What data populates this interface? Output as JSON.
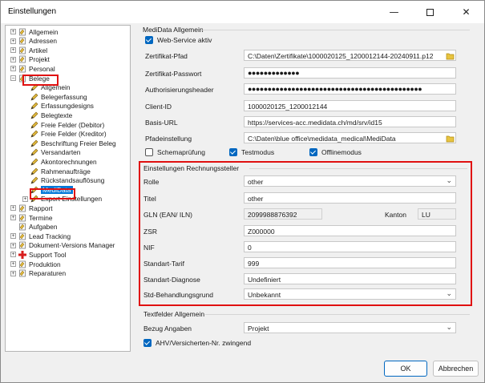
{
  "window": {
    "title": "Einstellungen"
  },
  "tree": {
    "items": [
      {
        "label": "Allgemein",
        "level": 0,
        "expander": "+"
      },
      {
        "label": "Adressen",
        "level": 0,
        "expander": "+"
      },
      {
        "label": "Artikel",
        "level": 0,
        "expander": "+"
      },
      {
        "label": "Projekt",
        "level": 0,
        "expander": "+"
      },
      {
        "label": "Personal",
        "level": 0,
        "expander": "+"
      },
      {
        "label": "Belege",
        "level": 0,
        "expander": "-"
      },
      {
        "label": "Allgemein",
        "level": 1
      },
      {
        "label": "Belegerfassung",
        "level": 1
      },
      {
        "label": "Erfassungdesigns",
        "level": 1
      },
      {
        "label": "Belegtexte",
        "level": 1
      },
      {
        "label": "Freie Felder (Debitor)",
        "level": 1
      },
      {
        "label": "Freie Felder (Kreditor)",
        "level": 1
      },
      {
        "label": "Beschriftung Freier Beleg",
        "level": 1
      },
      {
        "label": "Versandarten",
        "level": 1
      },
      {
        "label": "Akontorechnungen",
        "level": 1
      },
      {
        "label": "Rahmenaufträge",
        "level": 1
      },
      {
        "label": "Rückstandsauflösung",
        "level": 1
      },
      {
        "label": "MediData",
        "level": 1
      },
      {
        "label": "Export Einstellungen",
        "level": 1,
        "expander": "+"
      },
      {
        "label": "Rapport",
        "level": 0,
        "expander": "+"
      },
      {
        "label": "Termine",
        "level": 0,
        "expander": "+"
      },
      {
        "label": "Aufgaben",
        "level": 0
      },
      {
        "label": "Lead Tracking",
        "level": 0,
        "expander": "+"
      },
      {
        "label": "Dokument-Versions Manager",
        "level": 0,
        "expander": "+"
      },
      {
        "label": "Support Tool",
        "level": 0,
        "expander": "+"
      },
      {
        "label": "Produktion",
        "level": 0,
        "expander": "+"
      },
      {
        "label": "Reparaturen",
        "level": 0,
        "expander": "+"
      }
    ]
  },
  "medidata": {
    "section_title": "MediData Allgemein",
    "webservice_label": "Web-Service aktiv",
    "zertifikat_pfad_label": "Zertifikat-Pfad",
    "zertifikat_pfad_value": "C:\\Daten\\Zertifikate\\1000020125_1200012144-20240911.p12",
    "zertifikat_passwort_label": "Zertifikat-Passwort",
    "zertifikat_passwort_value": "●●●●●●●●●●●●●",
    "auth_header_label": "Authorisierungsheader",
    "auth_header_value": "●●●●●●●●●●●●●●●●●●●●●●●●●●●●●●●●●●●●●●●●●●●●",
    "client_id_label": "Client-ID",
    "client_id_value": "1000020125_1200012144",
    "basis_url_label": "Basis-URL",
    "basis_url_value": "https://services-acc.medidata.ch/md/srv/id15",
    "pfad_label": "Pfadeinstellung",
    "pfad_value": "C:\\Daten\\blue office\\medidata_medical\\MediData",
    "schema_label": "Schemaprüfung",
    "test_label": "Testmodus",
    "offline_label": "Offlinemodus"
  },
  "rechnung": {
    "section_title": "Einstellungen Rechnungssteller",
    "rolle_label": "Rolle",
    "rolle_value": "other",
    "titel_label": "Titel",
    "titel_value": "other",
    "gln_label": "GLN (EAN/ ILN)",
    "gln_value": "2099988876392",
    "kanton_label": "Kanton",
    "kanton_value": "LU",
    "zsr_label": "ZSR",
    "zsr_value": "Z000000",
    "nif_label": "NIF",
    "nif_value": "0",
    "tarif_label": "Standart-Tarif",
    "tarif_value": "999",
    "diagnose_label": "Standart-Diagnose",
    "diagnose_value": "Undefiniert",
    "grund_label": "Std-Behandlungsgrund",
    "grund_value": "Unbekannt"
  },
  "textfelder": {
    "section_title": "Textfelder Allgemein",
    "bezug_label": "Bezug Angaben",
    "bezug_value": "Projekt",
    "ahv_label": "AHV/Versicherten-Nr. zwingend"
  },
  "buttons": {
    "ok": "OK",
    "cancel": "Abbrechen"
  },
  "colors": {
    "accent": "#0067c0",
    "highlight": "#e01010",
    "selection": "#0078d7"
  }
}
